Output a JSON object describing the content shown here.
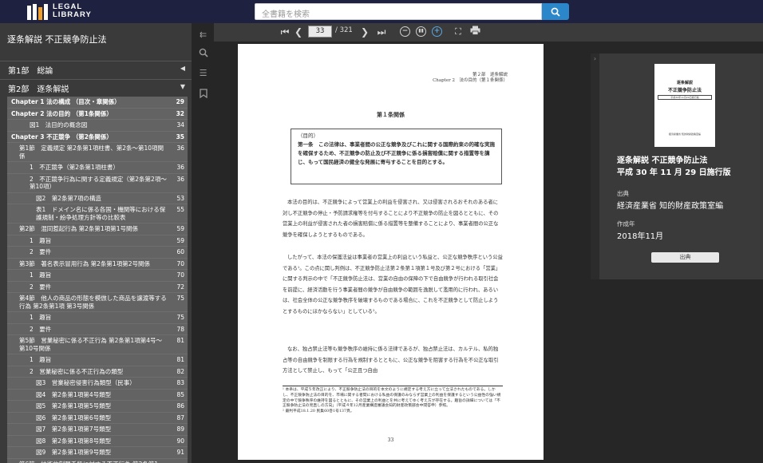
{
  "logo": {
    "line1": "LEGAL",
    "line2": "LIBRARY"
  },
  "search": {
    "placeholder": "全書籍を検索"
  },
  "sidebar": {
    "book_title": "逐条解説 不正競争防止法",
    "parts": [
      {
        "label": "第1部　総論"
      },
      {
        "label": "第2部　逐条解説"
      }
    ],
    "toc": [
      {
        "t": "Chapter 1 法の構成 （目次・章関係）",
        "p": "29",
        "b": true,
        "i": 0
      },
      {
        "t": "Chapter 2 法の目的 （第1条関係）",
        "p": "32",
        "b": true,
        "i": 0
      },
      {
        "t": "図1　法目的の概念図",
        "p": "34",
        "b": false,
        "i": 2
      },
      {
        "t": "Chapter 3 不正競争 （第2条関係）",
        "p": "35",
        "b": true,
        "i": 0
      },
      {
        "t": "第1節　定義規定 第2条第1項柱書、第2条～第10項関係",
        "p": "36",
        "b": false,
        "i": 1
      },
      {
        "t": "1　不正競争（第2条第1項柱書）",
        "p": "36",
        "b": false,
        "i": 2
      },
      {
        "t": "2　不正競争行為に関する定義規定（第2条第2項～第10項）",
        "p": "36",
        "b": false,
        "i": 2
      },
      {
        "t": "図2　第2条第7項の構造",
        "p": "53",
        "b": false,
        "i": 3
      },
      {
        "t": "表1　ドメイン名に係る各国・機関等における保護規制・紛争処理方針等の比較表",
        "p": "55",
        "b": false,
        "i": 3
      },
      {
        "t": "第2節　混同惹起行為 第2条第1項第1号関係",
        "p": "59",
        "b": false,
        "i": 1
      },
      {
        "t": "1　趣旨",
        "p": "59",
        "b": false,
        "i": 2
      },
      {
        "t": "2　要件",
        "p": "60",
        "b": false,
        "i": 2
      },
      {
        "t": "第3節　著名表示冒用行為 第2条第1項第2号関係",
        "p": "70",
        "b": false,
        "i": 1
      },
      {
        "t": "1　趣旨",
        "p": "70",
        "b": false,
        "i": 2
      },
      {
        "t": "2　要件",
        "p": "72",
        "b": false,
        "i": 2
      },
      {
        "t": "第4節　他人の商品の形態を模倣した商品を譲渡等する行為 第2条第1項 第3号関係",
        "p": "75",
        "b": false,
        "i": 1
      },
      {
        "t": "1　趣旨",
        "p": "75",
        "b": false,
        "i": 2
      },
      {
        "t": "2　要件",
        "p": "78",
        "b": false,
        "i": 2
      },
      {
        "t": "第5節　営業秘密に係る不正行為 第2条第1項第4号～第10号関係",
        "p": "81",
        "b": false,
        "i": 1
      },
      {
        "t": "1　趣旨",
        "p": "81",
        "b": false,
        "i": 2
      },
      {
        "t": "2　営業秘密に係る不正行為の類型",
        "p": "82",
        "b": false,
        "i": 2
      },
      {
        "t": "図3　営業秘密侵害行為類型（民事）",
        "p": "83",
        "b": false,
        "i": 3
      },
      {
        "t": "図4　第2条第1項第4号類型",
        "p": "85",
        "b": false,
        "i": 3
      },
      {
        "t": "図5　第2条第1項第5号類型",
        "p": "86",
        "b": false,
        "i": 3
      },
      {
        "t": "図6　第2条第1項第6号類型",
        "p": "87",
        "b": false,
        "i": 3
      },
      {
        "t": "図7　第2条第1項第7号類型",
        "p": "89",
        "b": false,
        "i": 3
      },
      {
        "t": "図8　第2条第1項第8号類型",
        "p": "90",
        "b": false,
        "i": 3
      },
      {
        "t": "図9　第2条第1項第9号類型",
        "p": "91",
        "b": false,
        "i": 3
      },
      {
        "t": "第6節　技術的制限手段に対する不正行為 第2条第1",
        "p": "",
        "b": false,
        "i": 1
      }
    ]
  },
  "viewer": {
    "page_current": "33",
    "page_total": "/ 321"
  },
  "page": {
    "header1": "第２部　逐条解説",
    "header2": "Chapter 2　法の目的（第１条関係）",
    "section": "第１条関係",
    "box_head": "（目的）",
    "box_text": "第一条　この法律は、事業者間の公正な競争及びこれに関する国際約束の的確な実施を確保するため、不正競争の防止及び不正競争に係る損害賠償に関する措置等を講じ、もって国民経済の健全な発展に寄与することを目的とする。",
    "para1": "本法の目的は、不正競争によって営業上の利益を侵害され、又は侵害されるおそれのある者に対し不正競争の停止・予防請求権等を付与することにより不正競争の防止を図るとともに、その営業上の利益が侵害された者の損害賠償に係る措置等を整備することにより、事業者間の公正な競争を確保しようとするものである。",
    "para2": "したがって、本法の保護法益は事業者の営業上の利益という私益と、公正な競争秩序という公益である¹。この点に関し判例は、不正競争防止法第２条第１項第１号及び第２号における「営業」に関する判示の中で「不正競争防止法は、営業の自由の保障の下で自由競争が行われる取引社会を前提に、経済活動を行う事業者間の競争が自由競争の範囲を逸脱して濫用的に行われ、あるいは、社会全体の公正な競争秩序を破壊するものである場合に、これを不正競争として防止しようとするものにほかならない」としている²。",
    "para3": "なお、独占禁止法等も競争秩序の維持に係る法律であるが、独占禁止法は、カルテル、私的独占等の自由競争を制限する行為を規制するとともに、公正な競争を阻害する行為を不公正な取引方法として禁止し、もって「公正且つ自由",
    "footnote1": "¹ 本条は、平成５年改正により、不正競争防止法の目的を本文のように規定する考え方に立って立法されたものである。しかし、不正競争防止法の目的を、市場に関する者間における私益の保護のみならず営業上の利益を保護するという公益性の強い規定の中で競争秩序の維持を図るとともに、その営業上の利益とを共に考えてゆく考え方が存在する。趣旨の詳細については「不正競争防止法の見直しの方向」（平成４年12月産業構造審議会知的財産政策部会中間答申）参照。",
    "footnote2": "² 最判平成18.1.20 民集60巻1号137頁。",
    "page_number": "33"
  },
  "panel": {
    "cover_line1": "逐条解説",
    "cover_line2": "不正競争防止法",
    "cover_line3": "平成30年11月29日施行版",
    "cover_line4": "経済産業省 知的財産政策室編",
    "title1": "逐条解説 不正競争防止法",
    "title2": "平成 30 年 11 月 29 日施行版",
    "source_label": "出典",
    "source_value": "経済産業省 知的財産政策室編",
    "date_label": "作成年",
    "date_value": "2018年11月",
    "button_label": "出典"
  }
}
